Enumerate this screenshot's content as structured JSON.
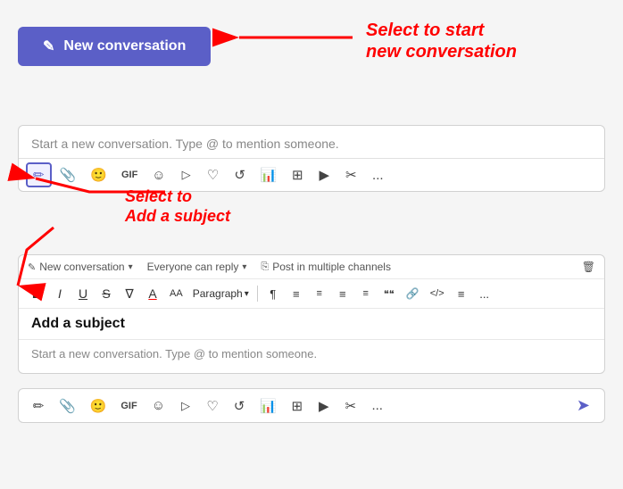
{
  "header": {
    "new_conversation_label": "New conversation",
    "new_conversation_icon": "✎"
  },
  "annotations": {
    "right_label_line1": "Select to start",
    "right_label_line2": "new conversation",
    "left_label_line1": "Select to",
    "left_label_line2": "Add a subject"
  },
  "compose_top": {
    "placeholder": "Start a new conversation. Type @ to mention someone."
  },
  "toolbar_top": {
    "buttons": [
      "✎",
      "📎",
      "😊",
      "GIF",
      "☺",
      "▷",
      "♀",
      "↺",
      "📊",
      "⊞",
      "▶",
      "✂",
      "..."
    ]
  },
  "meta_bar": {
    "new_conversation": "New conversation",
    "everyone_reply": "Everyone can reply",
    "post_multiple": "Post in multiple channels"
  },
  "formatting": {
    "bold": "B",
    "italic": "I",
    "underline": "U",
    "strikethrough": "S",
    "highlight": "A",
    "font_size": "AA",
    "paragraph": "Paragraph",
    "buttons_after": [
      "¶",
      "≡",
      "≡",
      "≡",
      "≡",
      "❝❝",
      "🔗",
      "</>",
      "≡",
      "..."
    ]
  },
  "compose_expanded": {
    "subject_placeholder": "Add a subject",
    "body_placeholder": "Start a new conversation. Type @ to mention someone."
  },
  "bottom_toolbar": {
    "buttons": [
      "✎",
      "📎",
      "😊",
      "GIF",
      "☺",
      "▷",
      "♀",
      "↺",
      "📊",
      "⊞",
      "▶",
      "✂",
      "..."
    ]
  }
}
